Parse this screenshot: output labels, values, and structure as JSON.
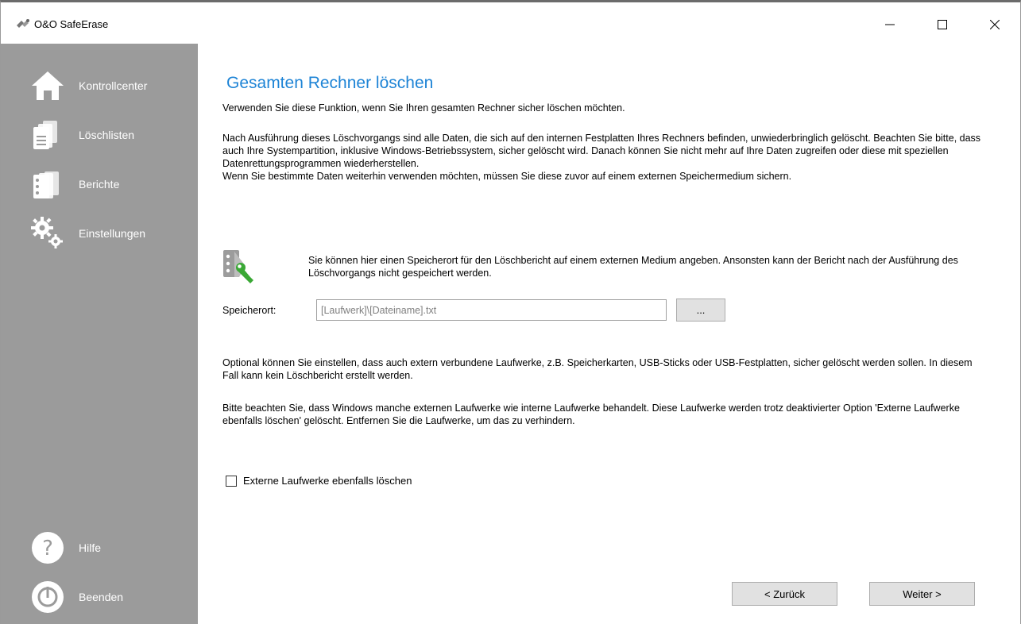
{
  "window": {
    "title": "O&O SafeErase",
    "controls": {
      "minimize": "minimize-icon",
      "maximize": "maximize-icon",
      "close": "close-icon"
    }
  },
  "sidebar": {
    "items": [
      {
        "label": "Kontrollcenter",
        "icon": "home-icon"
      },
      {
        "label": "Löschlisten",
        "icon": "lists-icon"
      },
      {
        "label": "Berichte",
        "icon": "reports-icon"
      },
      {
        "label": "Einstellungen",
        "icon": "settings-icon"
      }
    ],
    "bottom": [
      {
        "label": "Hilfe",
        "icon": "help-icon"
      },
      {
        "label": "Beenden",
        "icon": "power-icon"
      }
    ]
  },
  "main": {
    "title": "Gesamten Rechner löschen",
    "intro": "Verwenden Sie diese Funktion, wenn Sie Ihren gesamten Rechner sicher löschen möchten.",
    "description": "Nach Ausführung  dieses Löschvorgangs sind alle Daten, die sich auf den internen Festplatten Ihres Rechners befinden, unwiederbringlich gelöscht. Beachten Sie bitte, dass auch Ihre Systempartition, inklusive Windows-Betriebssystem, sicher gelöscht wird. Danach können Sie nicht mehr auf Ihre Daten zugreifen oder diese mit speziellen Datenrettungsprogrammen wiederherstellen.\nWenn Sie bestimmte Daten weiterhin verwenden möchten, müssen Sie diese zuvor auf einem externen Speichermedium sichern.",
    "report_info": "Sie können hier einen Speicherort  für den Löschbericht auf einem externen Medium angeben. Ansonsten kann der Bericht nach der Ausführung des Löschvorgangs nicht gespeichert werden.",
    "speicherort": {
      "label": "Speicherort:",
      "value": "",
      "placeholder": "[Laufwerk]\\[Dateiname].txt",
      "browse_label": "..."
    },
    "optional_text": "Optional können Sie einstellen, dass auch extern verbundene Laufwerke, z.B. Speicherkarten, USB-Sticks oder USB-Festplatten, sicher gelöscht werden sollen. In diesem Fall kann kein Löschbericht erstellt werden.",
    "warning_text": "Bitte beachten Sie, dass Windows manche externen Laufwerke wie interne Laufwerke behandelt. Diese Laufwerke werden trotz deaktivierter Option 'Externe Laufwerke ebenfalls löschen' gelöscht. Entfernen Sie die Laufwerke, um das zu verhindern.",
    "checkbox": {
      "label": "Externe Laufwerke ebenfalls löschen",
      "checked": false
    },
    "buttons": {
      "back": "< Zurück",
      "next": "Weiter >"
    }
  },
  "colors": {
    "sidebar": "#9b9b9b",
    "title": "#1e84d6",
    "accent_green": "#3aa835"
  }
}
